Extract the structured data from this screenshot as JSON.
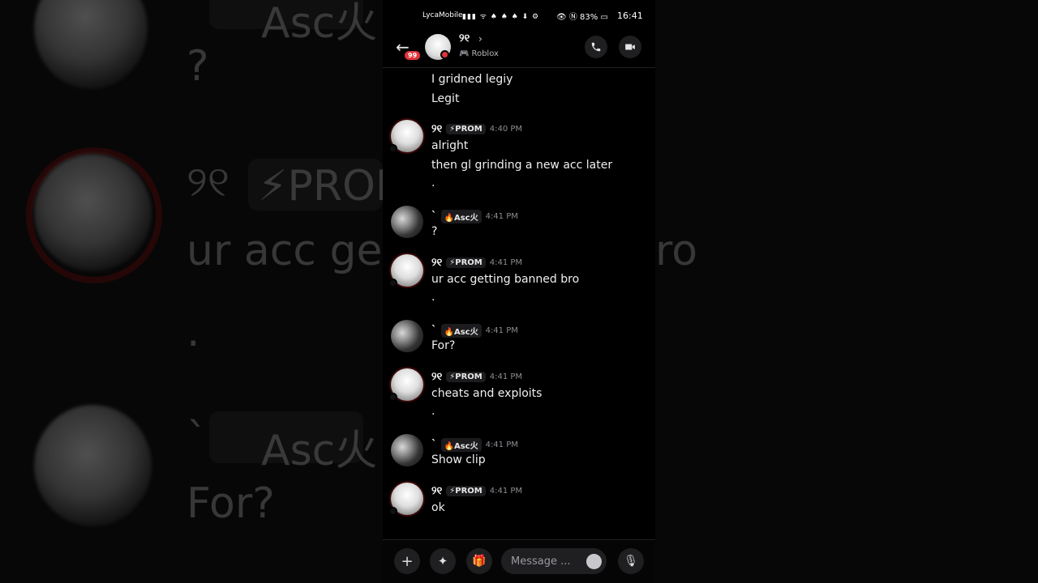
{
  "background": {
    "big_name": "୨୧",
    "big_tag": "⚡PROM",
    "big_asc": "Asc火",
    "big_q": "?",
    "big_line": "ur acc get",
    "big_line_end": "ro",
    "big_dot": ".",
    "big_for": "For?",
    "big_tick": "`"
  },
  "status_bar": {
    "carrier": "LycaMobile",
    "icons": "▮▮▮ ᯤ ♠ ♠ ♠ ⬇ ⚙",
    "right": "👁 Ⓝ 83% ▭",
    "time": "16:41"
  },
  "header": {
    "back_icon": "←",
    "unread_badge": "99",
    "name": "୨୧",
    "chevron": "›",
    "activity_icon": "🎮",
    "activity": "Roblox",
    "call_icon": "phone-icon",
    "video_icon": "video-icon"
  },
  "messages": {
    "prior_lines": [
      "I gridned legiy",
      "Legit"
    ],
    "groups": [
      {
        "user": "୨୧",
        "tag": "⚡PROM",
        "time": "4:40 PM",
        "lines": [
          "alright",
          "then gl grinding a new acc later",
          "."
        ]
      },
      {
        "user": "`",
        "tag": "🔥Asc火",
        "time": "4:41 PM",
        "lines": [
          "?"
        ]
      },
      {
        "user": "୨୧",
        "tag": "⚡PROM",
        "time": "4:41 PM",
        "lines": [
          "ur acc getting banned bro",
          "."
        ]
      },
      {
        "user": "`",
        "tag": "🔥Asc火",
        "time": "4:41 PM",
        "lines": [
          "For?"
        ]
      },
      {
        "user": "୨୧",
        "tag": "⚡PROM",
        "time": "4:41 PM",
        "lines": [
          "cheats and exploits",
          "."
        ]
      },
      {
        "user": "`",
        "tag": "🔥Asc火",
        "time": "4:41 PM",
        "lines": [
          "Show clip"
        ]
      },
      {
        "user": "୨୧",
        "tag": "⚡PROM",
        "time": "4:41 PM",
        "lines": [
          "ok"
        ]
      }
    ]
  },
  "composer": {
    "plus": "+",
    "apps": "✦",
    "gift": "🎁",
    "placeholder": "Message ...",
    "mic": "🎙"
  }
}
